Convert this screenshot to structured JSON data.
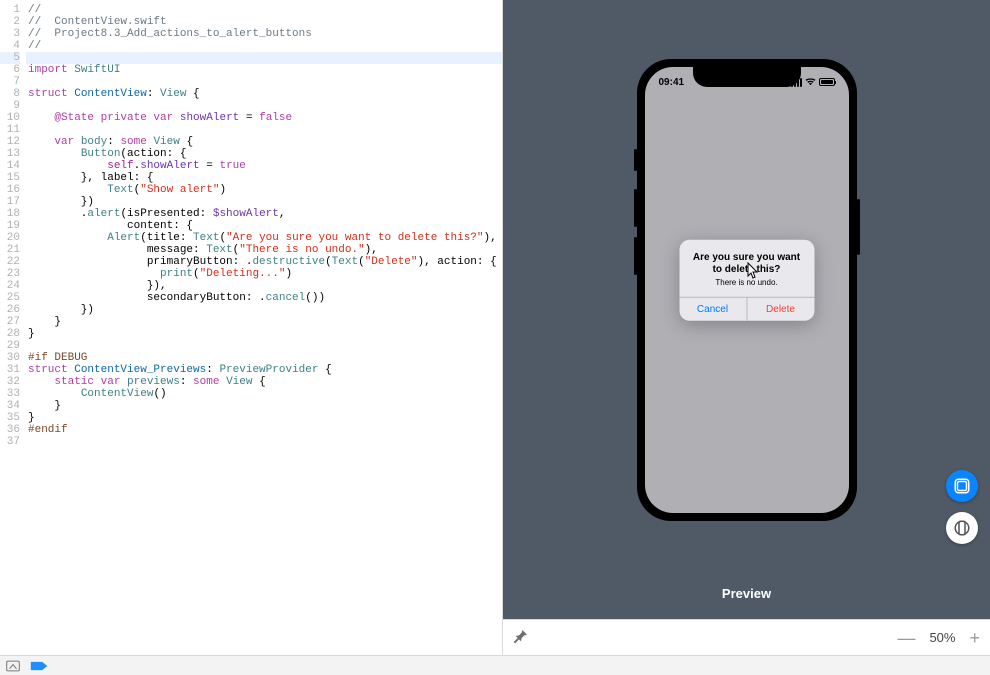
{
  "editor": {
    "highlighted_line": 5,
    "lines": [
      [
        [
          "c-comment",
          "//"
        ]
      ],
      [
        [
          "c-comment",
          "//  ContentView.swift"
        ]
      ],
      [
        [
          "c-comment",
          "//  Project8.3_Add_actions_to_alert_buttons"
        ]
      ],
      [
        [
          "c-comment",
          "//"
        ]
      ],
      [
        [
          "",
          ""
        ]
      ],
      [
        [
          "c-keyword",
          "import"
        ],
        [
          "",
          " "
        ],
        [
          "c-type",
          "SwiftUI"
        ]
      ],
      [
        [
          "",
          ""
        ]
      ],
      [
        [
          "c-keyword",
          "struct"
        ],
        [
          "",
          " "
        ],
        [
          "c-name",
          "ContentView"
        ],
        [
          "",
          ": "
        ],
        [
          "c-type",
          "View"
        ],
        [
          "",
          " {"
        ]
      ],
      [
        [
          "",
          ""
        ]
      ],
      [
        [
          "",
          "    "
        ],
        [
          "c-keyword",
          "@State"
        ],
        [
          "",
          " "
        ],
        [
          "c-keyword",
          "private var"
        ],
        [
          "",
          " "
        ],
        [
          "c-prop",
          "showAlert"
        ],
        [
          "",
          " = "
        ],
        [
          "c-keyword",
          "false"
        ]
      ],
      [
        [
          "",
          ""
        ]
      ],
      [
        [
          "",
          "    "
        ],
        [
          "c-keyword",
          "var"
        ],
        [
          "",
          " "
        ],
        [
          "c-attr",
          "body"
        ],
        [
          "",
          ": "
        ],
        [
          "c-keyword",
          "some"
        ],
        [
          "",
          " "
        ],
        [
          "c-type",
          "View"
        ],
        [
          "",
          " {"
        ]
      ],
      [
        [
          "",
          "        "
        ],
        [
          "c-type",
          "Button"
        ],
        [
          "",
          "(action: {"
        ]
      ],
      [
        [
          "",
          "            "
        ],
        [
          "c-self",
          "self"
        ],
        [
          "",
          "."
        ],
        [
          "c-prop",
          "showAlert"
        ],
        [
          "",
          " = "
        ],
        [
          "c-keyword",
          "true"
        ]
      ],
      [
        [
          "",
          "        }, label: {"
        ]
      ],
      [
        [
          "",
          "            "
        ],
        [
          "c-type",
          "Text"
        ],
        [
          "",
          "("
        ],
        [
          "c-string",
          "\"Show alert\""
        ],
        [
          "",
          ")"
        ]
      ],
      [
        [
          "",
          "        })"
        ]
      ],
      [
        [
          "",
          "        ."
        ],
        [
          "c-attr",
          "alert"
        ],
        [
          "",
          "(isPresented: "
        ],
        [
          "c-prop",
          "$showAlert"
        ],
        [
          "",
          ","
        ]
      ],
      [
        [
          "",
          "               content: {"
        ]
      ],
      [
        [
          "",
          "            "
        ],
        [
          "c-type",
          "Alert"
        ],
        [
          "",
          "(title: "
        ],
        [
          "c-type",
          "Text"
        ],
        [
          "",
          "("
        ],
        [
          "c-string",
          "\"Are you sure you want to delete this?\""
        ],
        [
          "",
          ")"
        ],
        [
          "",
          ","
        ]
      ],
      [
        [
          "",
          "                  message: "
        ],
        [
          "c-type",
          "Text"
        ],
        [
          "",
          "("
        ],
        [
          "c-string",
          "\"There is no undo.\""
        ],
        [
          "",
          ")"
        ],
        [
          "",
          ","
        ]
      ],
      [
        [
          "",
          "                  primaryButton: ."
        ],
        [
          "c-attr",
          "destructive"
        ],
        [
          "",
          "("
        ],
        [
          "c-type",
          "Text"
        ],
        [
          "",
          "("
        ],
        [
          "c-string",
          "\"Delete\""
        ],
        [
          "",
          "), action: {"
        ]
      ],
      [
        [
          "",
          "                    "
        ],
        [
          "c-attr",
          "print"
        ],
        [
          "",
          "("
        ],
        [
          "c-string",
          "\"Deleting...\""
        ],
        [
          "",
          ")"
        ]
      ],
      [
        [
          "",
          "                  })"
        ],
        [
          "",
          ","
        ]
      ],
      [
        [
          "",
          "                  secondaryButton: ."
        ],
        [
          "c-attr",
          "cancel"
        ],
        [
          "",
          "())"
        ]
      ],
      [
        [
          "",
          "        })"
        ]
      ],
      [
        [
          "",
          "    }"
        ]
      ],
      [
        [
          "",
          "}"
        ]
      ],
      [
        [
          "",
          ""
        ]
      ],
      [
        [
          "c-pre",
          "#if DEBUG"
        ]
      ],
      [
        [
          "c-keyword",
          "struct"
        ],
        [
          "",
          " "
        ],
        [
          "c-name",
          "ContentView_Previews"
        ],
        [
          "",
          ": "
        ],
        [
          "c-type",
          "PreviewProvider"
        ],
        [
          "",
          " {"
        ]
      ],
      [
        [
          "",
          "    "
        ],
        [
          "c-keyword",
          "static var"
        ],
        [
          "",
          " "
        ],
        [
          "c-attr",
          "previews"
        ],
        [
          "",
          ": "
        ],
        [
          "c-keyword",
          "some"
        ],
        [
          "",
          " "
        ],
        [
          "c-type",
          "View"
        ],
        [
          "",
          " {"
        ]
      ],
      [
        [
          "",
          "        "
        ],
        [
          "c-type",
          "ContentView"
        ],
        [
          "",
          "()"
        ]
      ],
      [
        [
          "",
          "    }"
        ]
      ],
      [
        [
          "",
          "}"
        ]
      ],
      [
        [
          "c-pre",
          "#endif"
        ]
      ],
      [
        [
          "",
          ""
        ]
      ]
    ]
  },
  "preview": {
    "label": "Preview",
    "zoom": "50%",
    "device_clock": "09:41",
    "alert": {
      "title": "Are you sure you want to delete this?",
      "message": "There is no undo.",
      "cancel": "Cancel",
      "delete": "Delete"
    }
  }
}
